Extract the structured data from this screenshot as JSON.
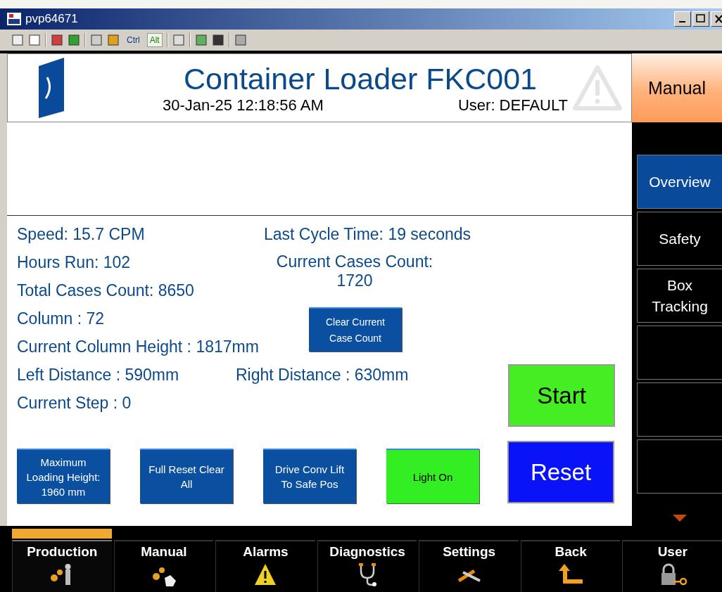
{
  "window": {
    "title": "pvp64671"
  },
  "toolbar": {
    "ctrl": {
      "label": "Ctrl",
      "pressed": false
    },
    "alt": {
      "label": "Alt",
      "pressed": true
    }
  },
  "header": {
    "title": "Container Loader FKC001",
    "datetime": "30-Jan-25 12:18:56 AM",
    "user": "User: DEFAULT",
    "mode": "Manual"
  },
  "sidebar": {
    "items": [
      {
        "label": "Overview",
        "selected": true
      },
      {
        "label": "Safety",
        "selected": false
      },
      {
        "label": "Box Tracking",
        "selected": false
      }
    ]
  },
  "stats": {
    "speed": "Speed: 15.7 CPM",
    "hours_run": "Hours Run: 102",
    "total_cases": "Total Cases Count: 8650",
    "column": "Column : 72",
    "column_height": "Current Column Height : 1817mm",
    "left_distance": "Left Distance : 590mm",
    "current_step": "Current Step : 0",
    "last_cycle": "Last Cycle Time: 19 seconds",
    "current_cases_label": "Current Cases Count:",
    "current_cases_value": "1720",
    "right_distance": "Right Distance : 630mm"
  },
  "clear_button": {
    "label": "Clear Current Case Count"
  },
  "start_button": {
    "label": "Start",
    "color": "#44ee22"
  },
  "reset_button": {
    "label": "Reset",
    "color": "#0a12f8"
  },
  "action_buttons": [
    {
      "label": "Maximum Loading Height: 1960 mm",
      "color": "#0a4fa0"
    },
    {
      "label": "Full Reset Clear All",
      "color": "#0a4fa0"
    },
    {
      "label": "Drive Conv Lift To Safe Pos",
      "color": "#0a4fa0"
    },
    {
      "label": "Light On",
      "color": "#33ee22"
    }
  ],
  "nav": [
    {
      "label": "Production",
      "selected": true
    },
    {
      "label": "Manual",
      "selected": false
    },
    {
      "label": "Alarms",
      "selected": false
    },
    {
      "label": "Diagnostics",
      "selected": false
    },
    {
      "label": "Settings",
      "selected": false
    },
    {
      "label": "Back",
      "selected": false
    },
    {
      "label": "User",
      "selected": false
    }
  ]
}
